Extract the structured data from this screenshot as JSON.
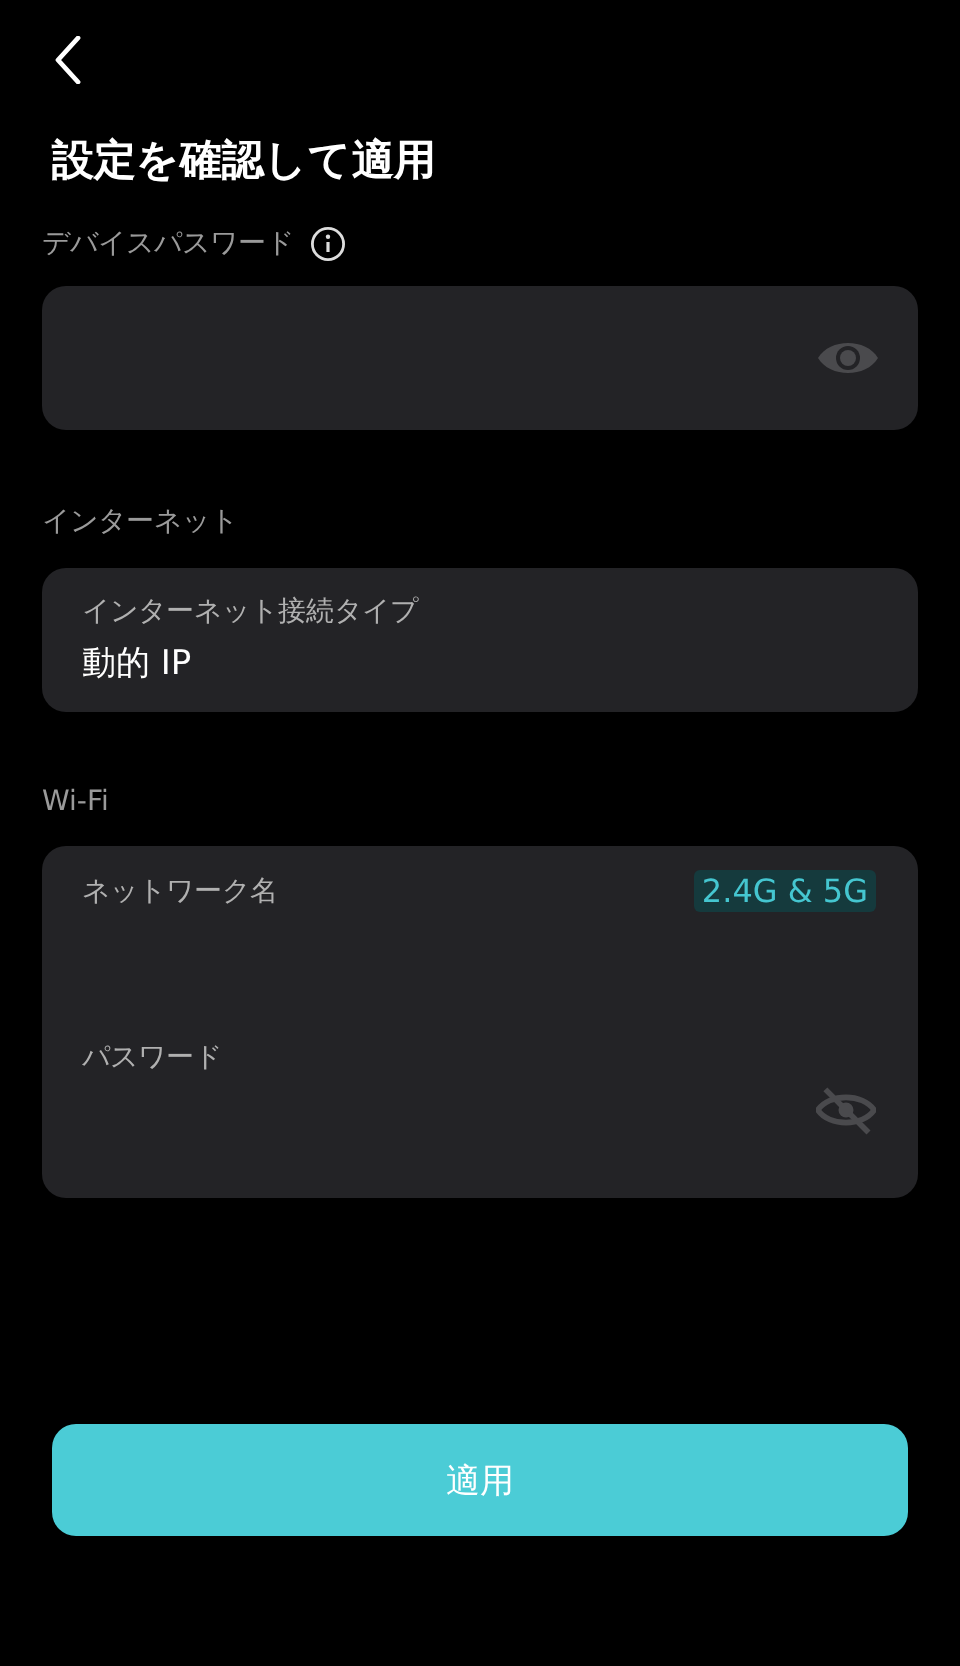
{
  "title": "設定を確認して適用",
  "device_password": {
    "label": "デバイスパスワード",
    "visible": true
  },
  "internet": {
    "heading": "インターネット",
    "label": "インターネット接続タイプ",
    "value": "動的 IP"
  },
  "wifi": {
    "heading": "Wi-Fi",
    "name_label": "ネットワーク名",
    "band_badge": "2.4G & 5G",
    "password_label": "パスワード",
    "password_visible": false
  },
  "apply_button": "適用"
}
